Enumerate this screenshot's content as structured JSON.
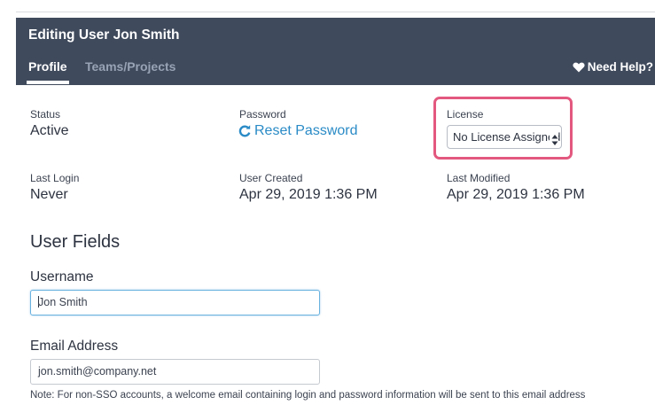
{
  "header": {
    "title": "Editing User Jon Smith",
    "tabs": [
      "Profile",
      "Teams/Projects"
    ],
    "help_label": "Need Help?"
  },
  "info": {
    "status_label": "Status",
    "status_value": "Active",
    "password_label": "Password",
    "reset_password_label": "Reset Password",
    "license_label": "License",
    "license_selected": "No License Assigned",
    "last_login_label": "Last Login",
    "last_login_value": "Never",
    "user_created_label": "User Created",
    "user_created_value": "Apr 29, 2019 1:36 PM",
    "last_modified_label": "Last Modified",
    "last_modified_value": "Apr 29, 2019 1:36 PM"
  },
  "user_fields": {
    "title": "User Fields",
    "username_label": "Username",
    "username_value": "Jon Smith",
    "email_label": "Email Address",
    "email_value": "jon.smith@company.net",
    "note": "Note: For non-SSO accounts, a welcome email containing login and password information will be sent to this email address"
  },
  "colors": {
    "header_bg": "#3f4a5d",
    "link": "#2a8bc6",
    "highlight": "#e2587f"
  }
}
